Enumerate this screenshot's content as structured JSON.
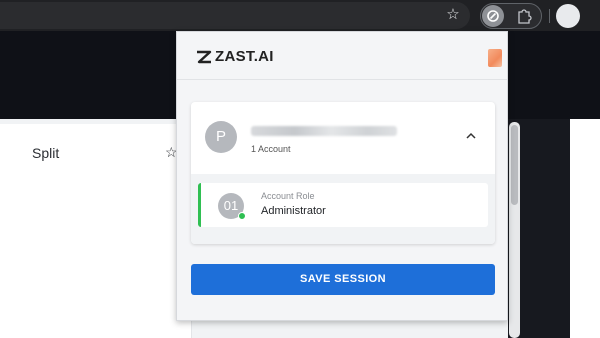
{
  "browser": {
    "star_icon": "star-icon",
    "extension_icon": "zast-extension-icon",
    "puzzle_icon": "puzzle-icon"
  },
  "page": {
    "split_label": "Split",
    "star_glyph": "☆"
  },
  "popup": {
    "logo_text": "ZAST.AI",
    "account": {
      "avatar_letter": "P",
      "count_label": "1 Account"
    },
    "role": {
      "number": "01",
      "label": "Account Role",
      "value": "Administrator",
      "status_color": "#2fbf52"
    },
    "save_button_label": "SAVE SESSION",
    "accent_color": "#1e6fd9"
  }
}
